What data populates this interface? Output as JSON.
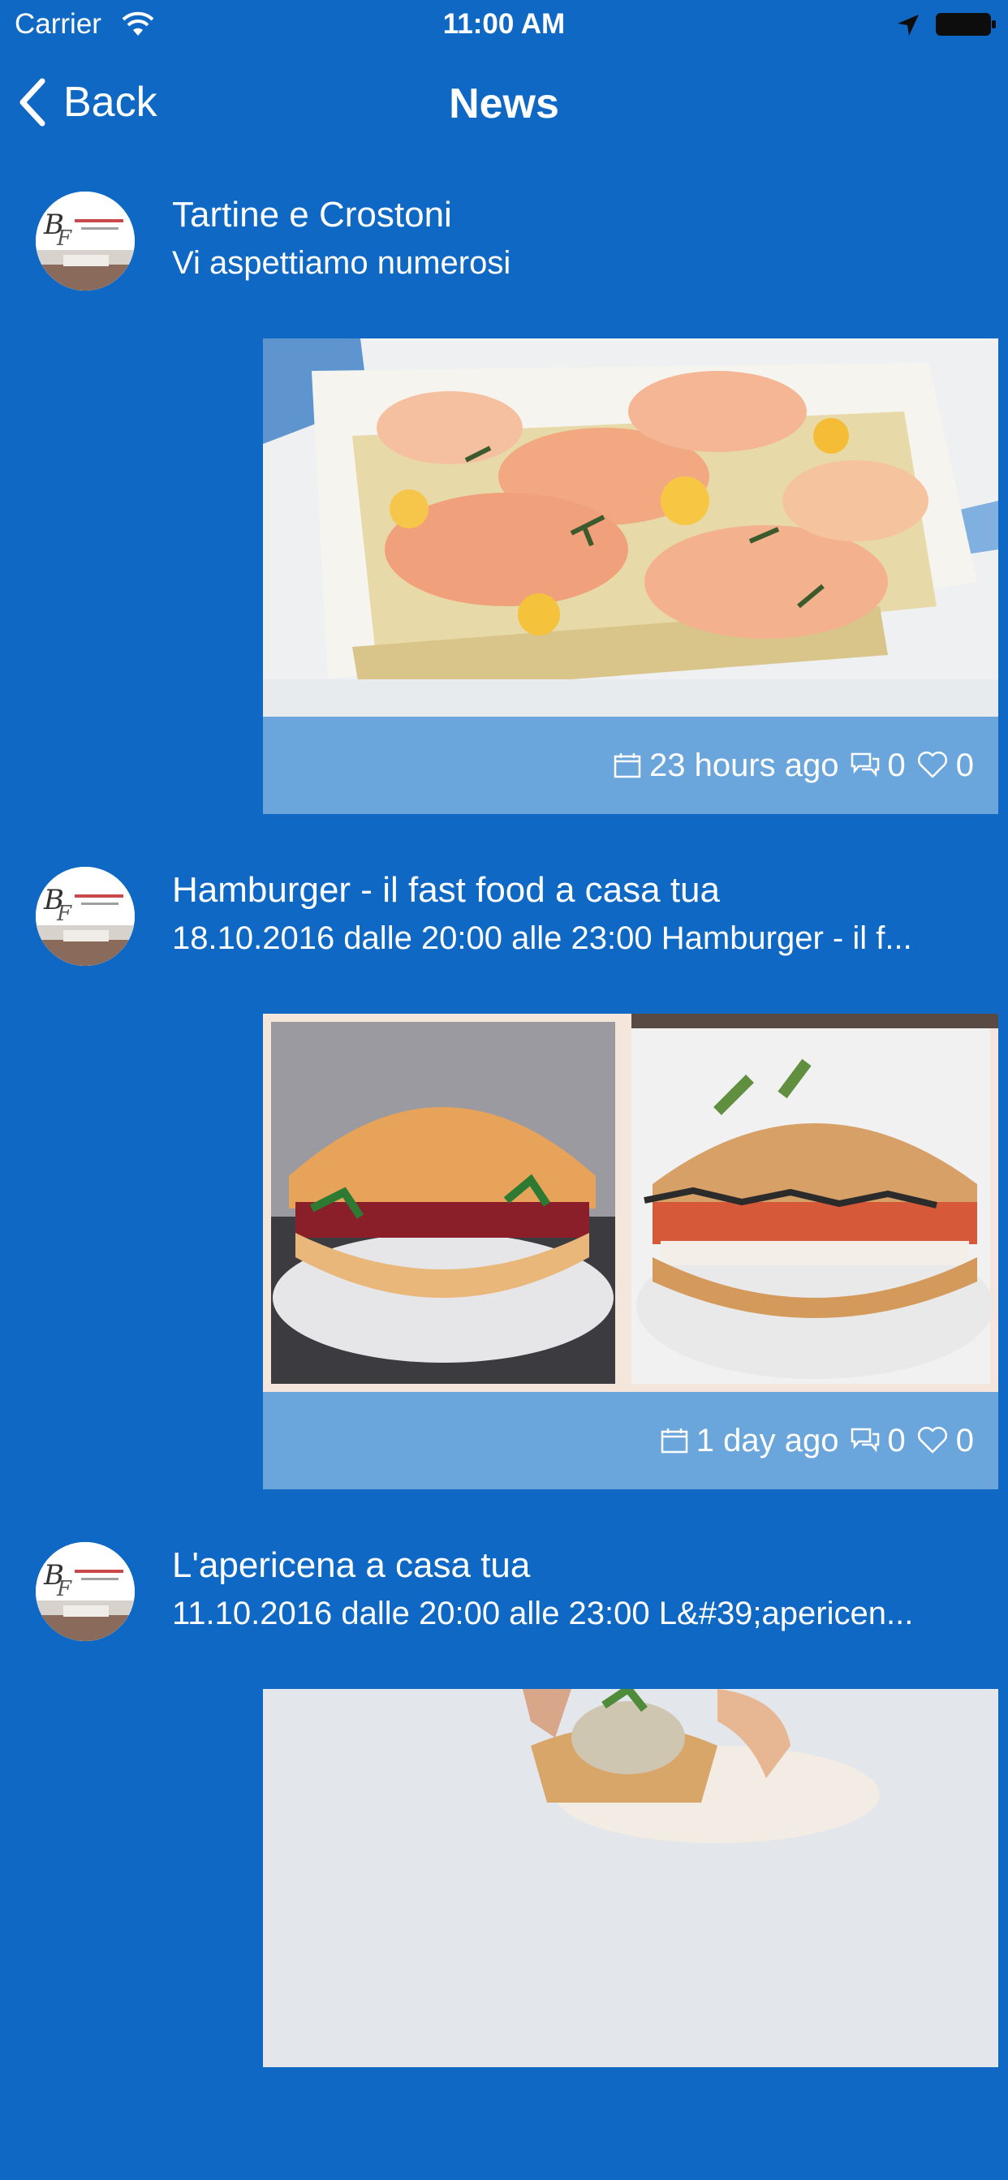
{
  "status_bar": {
    "carrier": "Carrier",
    "time": "11:00 AM"
  },
  "nav": {
    "back_label": "Back",
    "title": "News"
  },
  "colors": {
    "background": "#0f69c4",
    "meta_bar": "#6aa6dc",
    "text": "#ffffff"
  },
  "icons": [
    "wifi-icon",
    "location-arrow-icon",
    "battery-icon",
    "chevron-left-icon",
    "calendar-icon",
    "comment-icon",
    "heart-icon"
  ],
  "posts": [
    {
      "title": "Tartine e Crostoni",
      "subtitle": "Vi aspettiamo numerosi",
      "time_ago": "23 hours ago",
      "comments": "0",
      "likes": "0"
    },
    {
      "title": "Hamburger - il fast food a casa tua",
      "subtitle": "18.10.2016 dalle 20:00 alle 23:00 Hamburger - il f...",
      "time_ago": "1 day ago",
      "comments": "0",
      "likes": "0"
    },
    {
      "title": "L'apericena a casa tua",
      "subtitle": "11.10.2016 dalle 20:00 alle 23:00 L&#39;apericen..."
    }
  ]
}
